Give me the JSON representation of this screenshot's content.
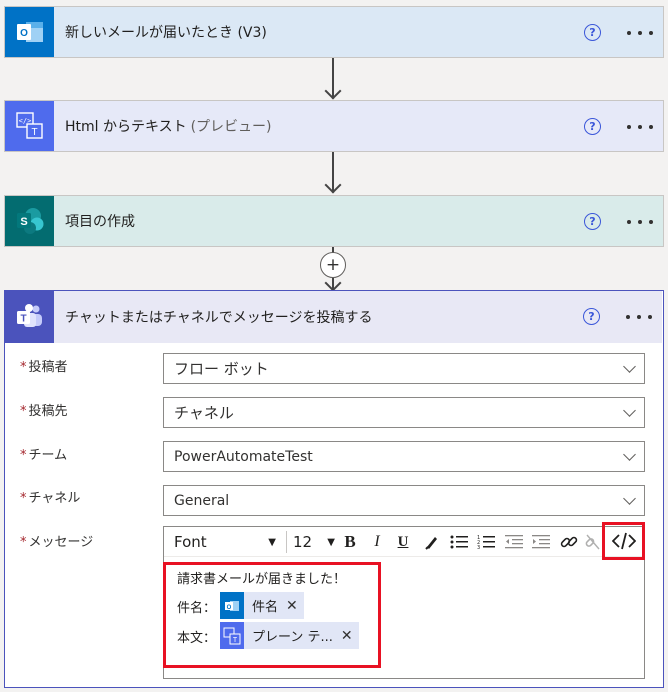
{
  "steps": [
    {
      "title": "新しいメールが届いたとき (V3)",
      "icon": "outlook-icon",
      "color": "#0072c6"
    },
    {
      "title": "Html からテキスト",
      "subtitle": "(プレビュー)",
      "icon": "html-to-text-icon",
      "color": "#4f6bed"
    },
    {
      "title": "項目の作成",
      "icon": "sharepoint-icon",
      "color": "#036c70"
    }
  ],
  "add_step": "+",
  "teams": {
    "title": "チャットまたはチャネルでメッセージを投稿する",
    "color": "#4b53bc",
    "fields": [
      {
        "label": "投稿者",
        "value": "フロー ボット"
      },
      {
        "label": "投稿先",
        "value": "チャネル"
      },
      {
        "label": "チーム",
        "value": "PowerAutomateTest"
      },
      {
        "label": "チャネル",
        "value": "General"
      }
    ],
    "message_label": "メッセージ",
    "required_mark": "*",
    "toolbar": {
      "font": "Font",
      "size": "12",
      "bold": "B",
      "italic": "I",
      "underline": "U"
    },
    "message": {
      "line1": "請求書メールが届きました！",
      "line2_label": "件名：",
      "token1": "件名",
      "line3_label": "本文：",
      "token2": "プレーン テ..."
    }
  },
  "icons": {
    "help": "?",
    "more": "more-icon",
    "close": "✕"
  },
  "highlight_color": "#e81123"
}
